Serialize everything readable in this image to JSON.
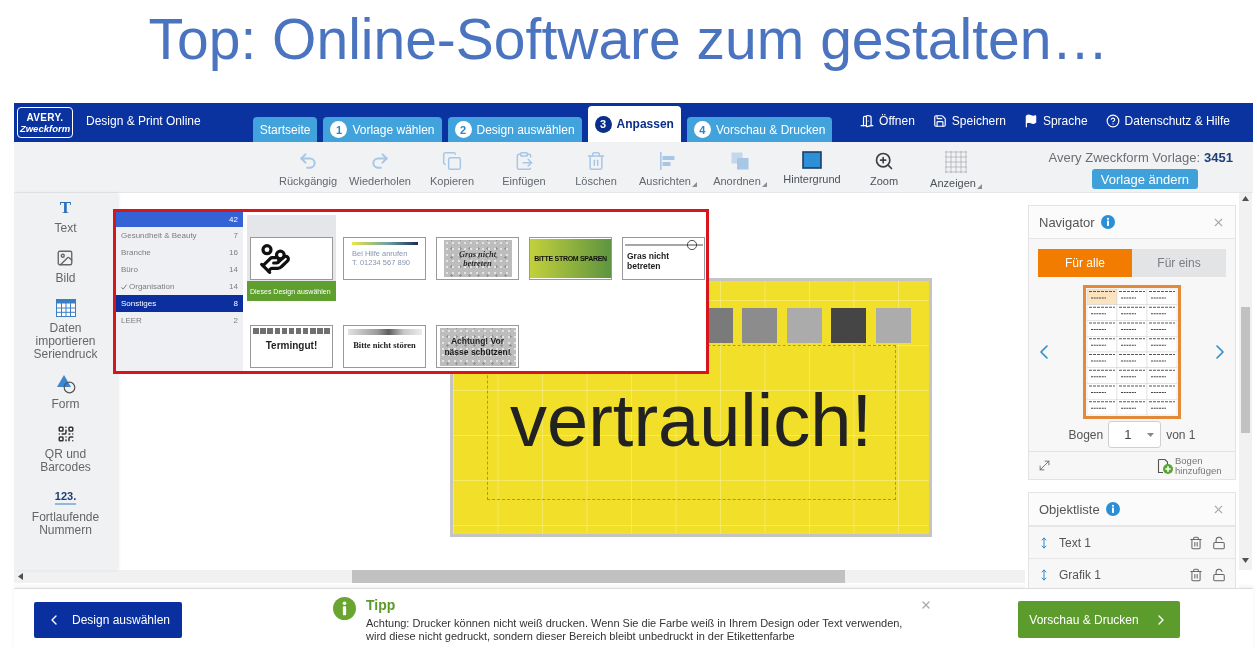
{
  "slide_title": "Top: Online-Software zum gestalten…",
  "header": {
    "logo": {
      "line_1": "AVERY.",
      "line_2": "Zweckform"
    },
    "app_name": "Design & Print Online",
    "tabs": [
      {
        "label": "Startseite",
        "selected": false
      },
      {
        "number": "1",
        "label": "Vorlage wählen",
        "selected": false
      },
      {
        "number": "2",
        "label": "Design auswählen",
        "selected": false
      },
      {
        "number": "3",
        "label": "Anpassen",
        "selected": true
      },
      {
        "number": "4",
        "label": "Vorschau & Drucken",
        "selected": false
      }
    ],
    "links": [
      {
        "kind": "open",
        "label": "Öffnen"
      },
      {
        "kind": "save",
        "label": "Speichern"
      },
      {
        "kind": "language",
        "label": "Sprache"
      },
      {
        "kind": "help",
        "label": "Datenschutz & Hilfe"
      }
    ]
  },
  "toolbar": {
    "tools": [
      {
        "kind": "undo",
        "label": "Rückgängig",
        "disabled": true,
        "has_menu": false
      },
      {
        "kind": "redo",
        "label": "Wiederholen",
        "disabled": true,
        "has_menu": false
      },
      {
        "kind": "copy",
        "label": "Kopieren",
        "disabled": true,
        "has_menu": false
      },
      {
        "kind": "paste",
        "label": "Einfügen",
        "disabled": true,
        "has_menu": false
      },
      {
        "kind": "delete",
        "label": "Löschen",
        "disabled": true,
        "has_menu": false
      },
      {
        "kind": "align",
        "label": "Ausrichten",
        "disabled": true,
        "has_menu": true
      },
      {
        "kind": "arrange",
        "label": "Anordnen",
        "disabled": true,
        "has_menu": true
      },
      {
        "kind": "background",
        "label": "Hintergrund",
        "disabled": false,
        "has_menu": false
      },
      {
        "kind": "zoom",
        "label": "Zoom",
        "disabled": false,
        "has_menu": false
      },
      {
        "kind": "grid",
        "label": "Anzeigen",
        "disabled": false,
        "has_menu": true
      }
    ],
    "template": {
      "label": "Avery Zweckform Vorlage:",
      "number": "3451",
      "button": "Vorlage ändern"
    }
  },
  "sidebar": {
    "items": [
      {
        "kind": "text",
        "glyph": "T",
        "label": "Text"
      },
      {
        "kind": "image",
        "label": "Bild"
      },
      {
        "kind": "data",
        "label": "Daten importieren Seriendruck"
      },
      {
        "kind": "shape",
        "label": "Form"
      },
      {
        "kind": "qr",
        "label": "QR und Barcodes"
      },
      {
        "kind": "numbering",
        "glyph": "123.",
        "label": "Fortlaufende Nummern"
      }
    ]
  },
  "canvas": {
    "label_text": "vertraulich!"
  },
  "design_picker": {
    "categories": [
      {
        "kind": "header",
        "count": "42",
        "selected": false,
        "checked": false
      },
      {
        "kind": "item",
        "label": "Gesundheit & Beauty",
        "count": "7",
        "selected": false,
        "checked": false
      },
      {
        "kind": "item",
        "label": "Branche",
        "count": "16",
        "selected": false,
        "checked": false
      },
      {
        "kind": "item",
        "label": "Büro",
        "count": "14",
        "selected": false,
        "checked": false
      },
      {
        "kind": "item",
        "label": "Organisation",
        "count": "14",
        "selected": false,
        "checked": true
      },
      {
        "kind": "item",
        "label": "Sonstiges",
        "count": "8",
        "selected": true,
        "checked": false
      },
      {
        "kind": "item",
        "label": "LEER",
        "count": "2",
        "selected": false,
        "checked": false
      }
    ],
    "select_button": "Dieses Design auswählen",
    "designs": [
      {
        "kind": "coins",
        "hovered": true
      },
      {
        "kind": "phone",
        "text": "Bei Hilfe anrufen",
        "subtext": "T. 01234 567 890",
        "hovered": false
      },
      {
        "kind": "textured_italic",
        "text": "Gras nicht betreten",
        "hovered": false
      },
      {
        "kind": "green_banner",
        "text": "BITTE STROM SPAREN",
        "hovered": false
      },
      {
        "kind": "line_circle",
        "text": "Gras nicht betreten",
        "hovered": false
      },
      {
        "kind": "squares",
        "text": "Termingut!",
        "hovered": false
      },
      {
        "kind": "gray_bar",
        "text": "Bitte nicht stören",
        "hovered": false
      },
      {
        "kind": "textured_bold",
        "text": "Achtung! Vor nässe schützen!",
        "hovered": false
      }
    ]
  },
  "navigator": {
    "title": "Navigator",
    "modes": [
      {
        "label": "Für alle",
        "selected": true
      },
      {
        "label": "Für eins",
        "selected": false
      }
    ],
    "sheet_label": "Bogen",
    "sheet_value": "1",
    "sheet_total": "von 1",
    "add_sheet": "Bogen hinzufügen"
  },
  "object_list": {
    "title": "Objektliste",
    "objects": [
      {
        "name": "Text 1",
        "locked": false
      },
      {
        "name": "Grafik 1",
        "locked": false
      }
    ]
  },
  "footer": {
    "back_button": "Design auswählen",
    "tip_title": "Tipp",
    "tip_text": "Achtung: Drucker können nicht weiß drucken. Wenn Sie die Farbe weiß in Ihrem Design oder Text verwenden, wird diese nicht gedruckt, sondern dieser Bereich bleibt unbedruckt in der Etikettenfarbe",
    "next_button": "Vorschau & Drucken"
  }
}
